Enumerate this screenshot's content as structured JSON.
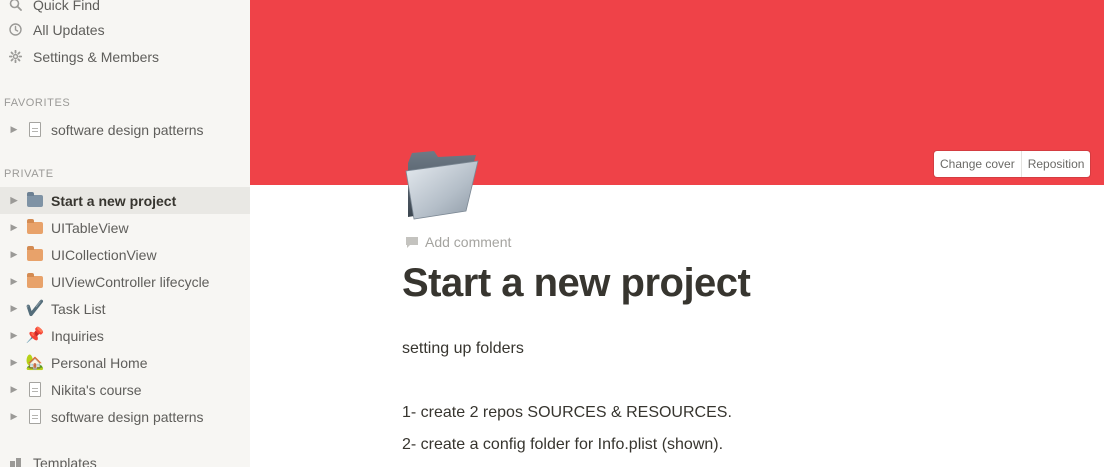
{
  "sidebar": {
    "top_items": [
      {
        "label": "Quick Find",
        "icon": "search-icon"
      },
      {
        "label": "All Updates",
        "icon": "clock-icon"
      },
      {
        "label": "Settings & Members",
        "icon": "gear-icon"
      }
    ],
    "favorites_label": "FAVORITES",
    "favorites": [
      {
        "label": "software design patterns",
        "icon": "document-icon"
      }
    ],
    "private_label": "PRIVATE",
    "private": [
      {
        "label": "Start a new project",
        "icon": "folder-icon",
        "active": true
      },
      {
        "label": "UITableView",
        "icon": "package-icon"
      },
      {
        "label": "UICollectionView",
        "icon": "package-icon"
      },
      {
        "label": "UIViewController lifecycle",
        "icon": "package-icon"
      },
      {
        "label": "Task List",
        "icon": "check-mark-icon",
        "emoji": "✔️"
      },
      {
        "label": "Inquiries",
        "icon": "pushpin-icon",
        "emoji": "📌"
      },
      {
        "label": "Personal Home",
        "icon": "house-icon",
        "emoji": "🏡"
      },
      {
        "label": "Nikita's course",
        "icon": "document-icon"
      },
      {
        "label": "software design patterns",
        "icon": "document-icon"
      }
    ],
    "templates_label": "Templates"
  },
  "cover": {
    "color": "#ef4248",
    "change_cover_label": "Change cover",
    "reposition_label": "Reposition"
  },
  "page": {
    "icon": "folder-icon",
    "add_comment_label": "Add comment",
    "title": "Start a new project",
    "lines": [
      "setting up folders",
      "1- create 2 repos SOURCES & RESOURCES.",
      "2- create a config folder for Info.plist (shown)."
    ]
  }
}
